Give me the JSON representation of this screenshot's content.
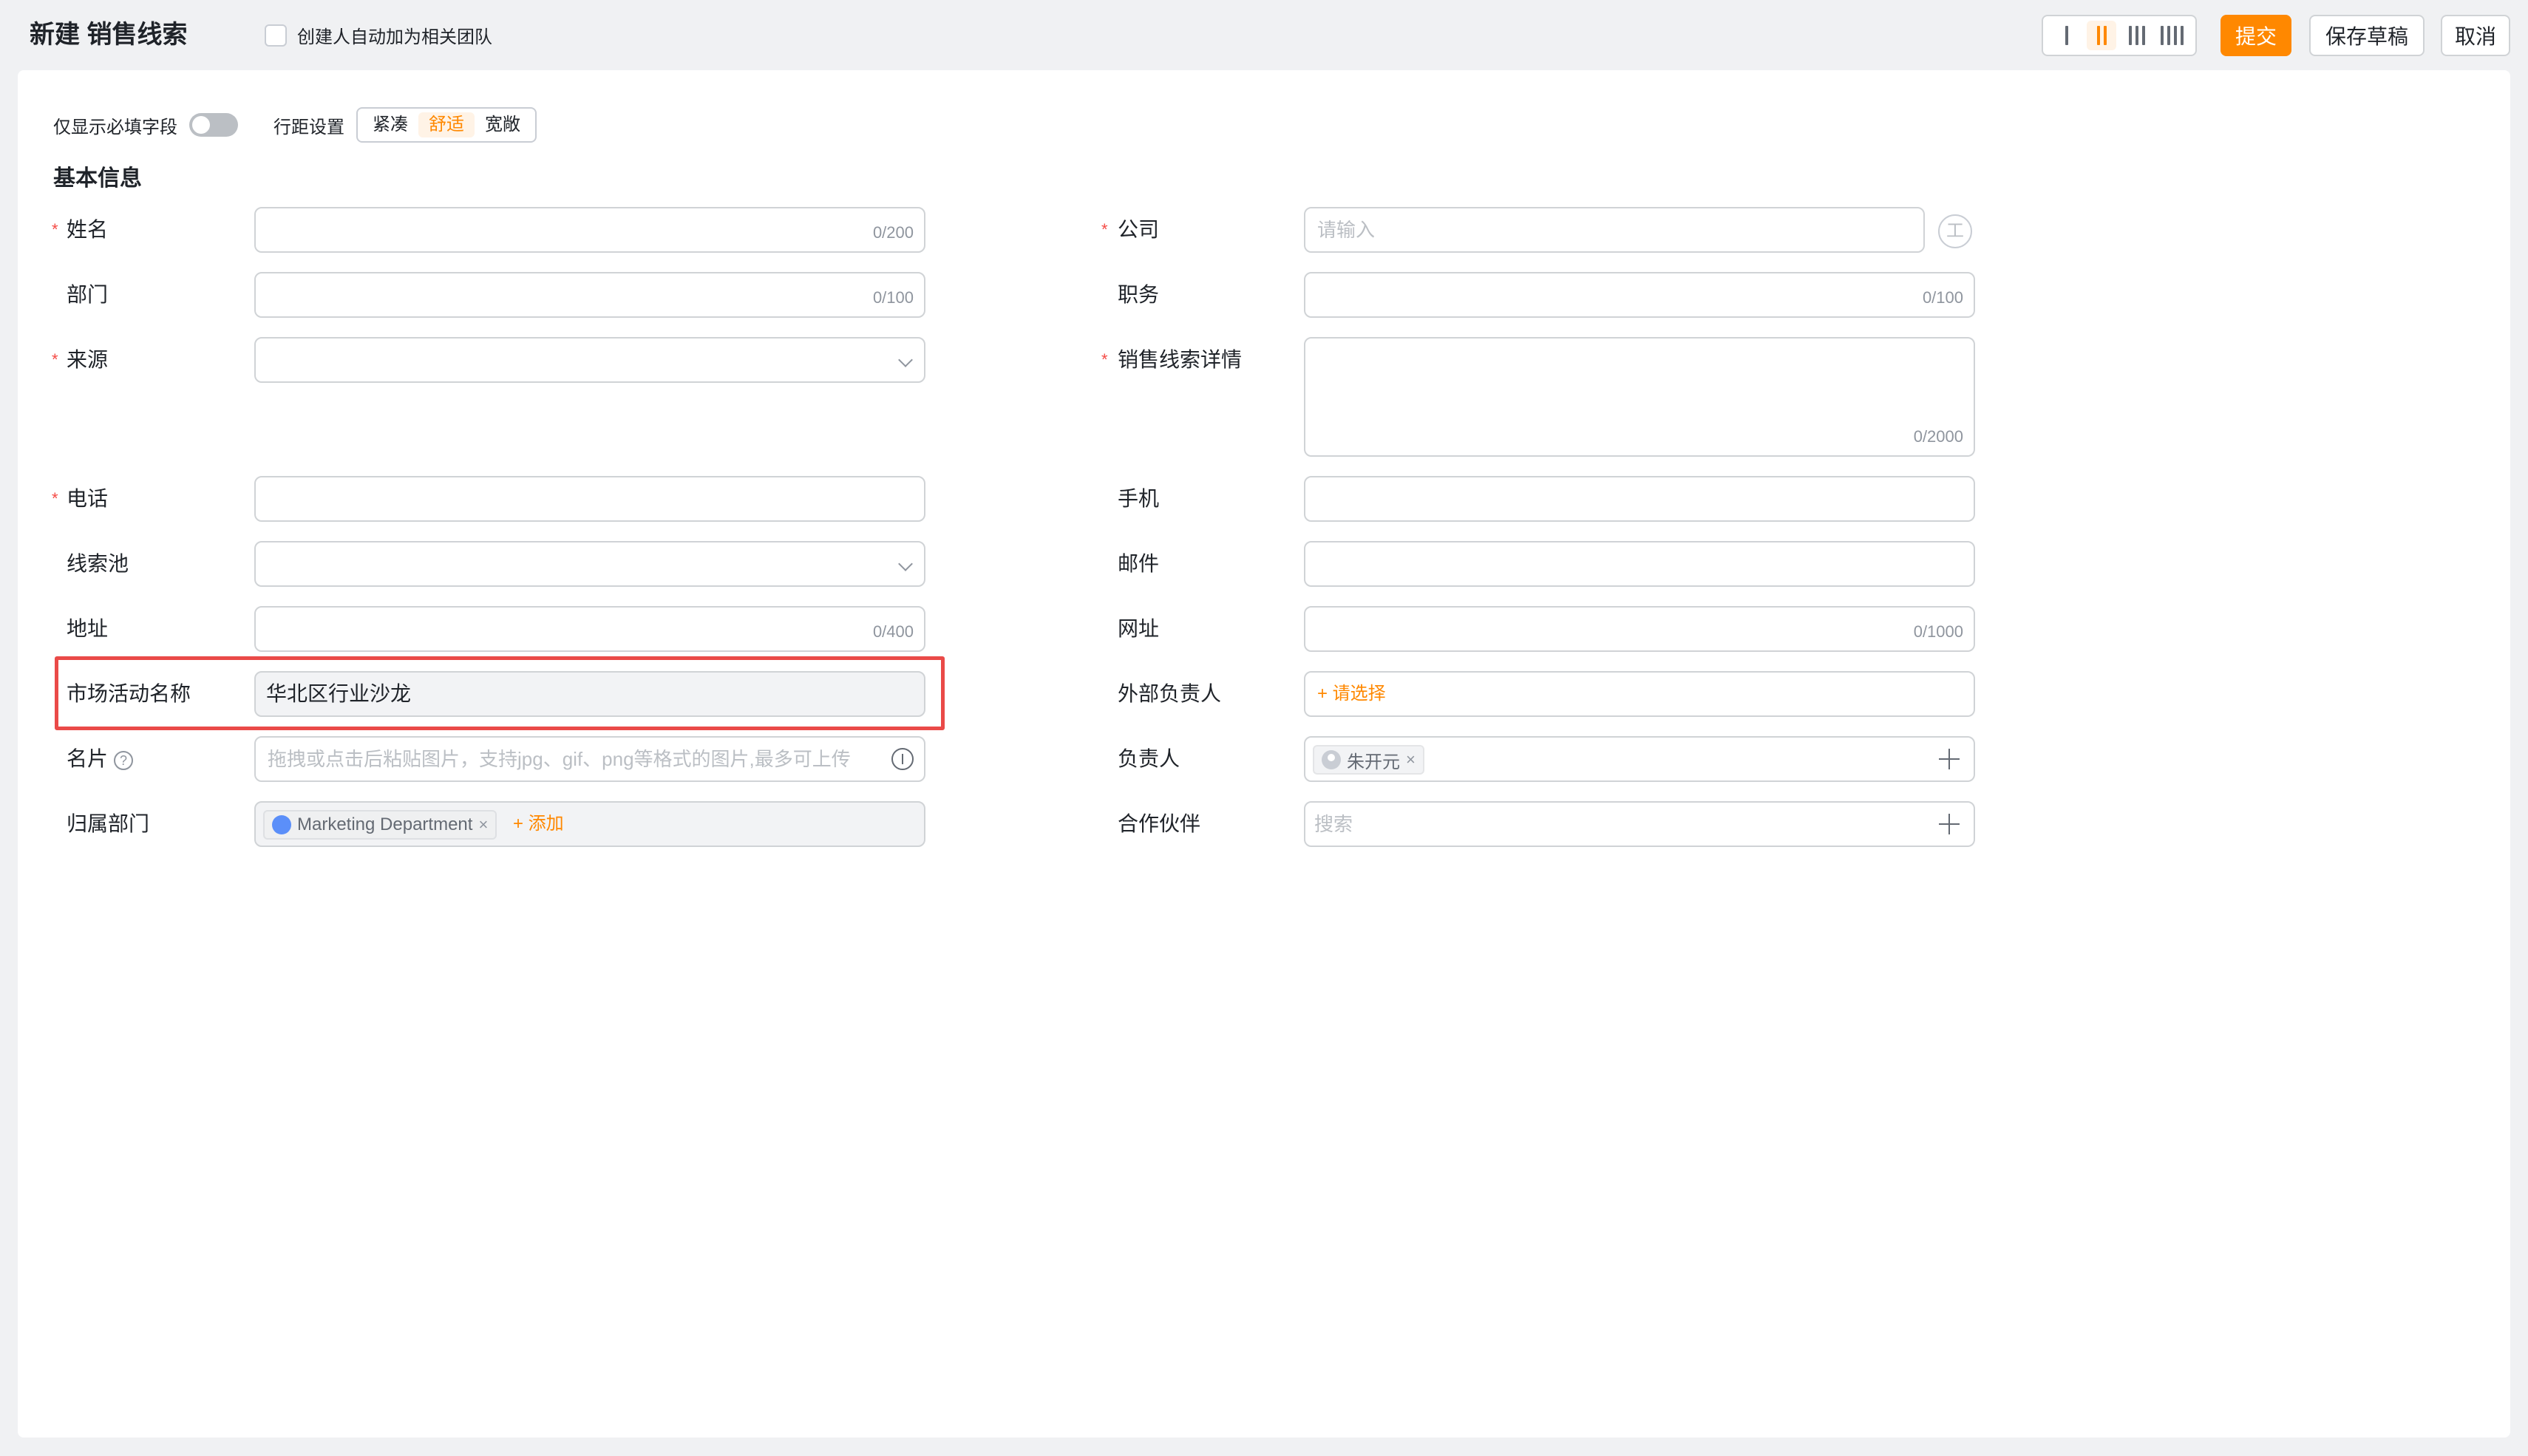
{
  "header": {
    "title": "新建 销售线索",
    "auto_team_label": "创建人自动加为相关团队",
    "buttons": {
      "submit": "提交",
      "save_draft": "保存草稿",
      "cancel": "取消"
    }
  },
  "toolbar": {
    "required_only_label": "仅显示必填字段",
    "spacing_label": "行距设置",
    "spacing_options": [
      "紧凑",
      "舒适",
      "宽敞"
    ],
    "spacing_selected": "舒适"
  },
  "section_title": "基本信息",
  "fields": {
    "name": {
      "label": "姓名",
      "counter": "0/200"
    },
    "company": {
      "label": "公司",
      "placeholder": "请输入",
      "icon_text": "工"
    },
    "department": {
      "label": "部门",
      "counter": "0/100"
    },
    "position": {
      "label": "职务",
      "counter": "0/100"
    },
    "source": {
      "label": "来源"
    },
    "lead_detail": {
      "label": "销售线索详情",
      "counter": "0/2000"
    },
    "phone": {
      "label": "电话"
    },
    "mobile": {
      "label": "手机"
    },
    "lead_pool": {
      "label": "线索池"
    },
    "email": {
      "label": "邮件"
    },
    "address": {
      "label": "地址",
      "counter": "0/400"
    },
    "website": {
      "label": "网址",
      "counter": "0/1000"
    },
    "campaign_name": {
      "label": "市场活动名称",
      "value": "华北区行业沙龙"
    },
    "external_owner": {
      "label": "外部负责人",
      "link": "+ 请选择"
    },
    "business_card": {
      "label": "名片",
      "help": "?",
      "placeholder": "拖拽或点击后粘贴图片，支持jpg、gif、png等格式的图片,最多可上传"
    },
    "owner": {
      "label": "负责人",
      "tag": "朱开元",
      "tag_close": "×"
    },
    "owning_dept": {
      "label": "归属部门",
      "tag": "Marketing Department",
      "tag_close": "×",
      "add": "+ 添加"
    },
    "partner": {
      "label": "合作伙伴",
      "placeholder": "搜索"
    }
  },
  "colors": {
    "accent": "#ff8800",
    "required": "#f54a45",
    "highlight": "#ea4a48"
  }
}
